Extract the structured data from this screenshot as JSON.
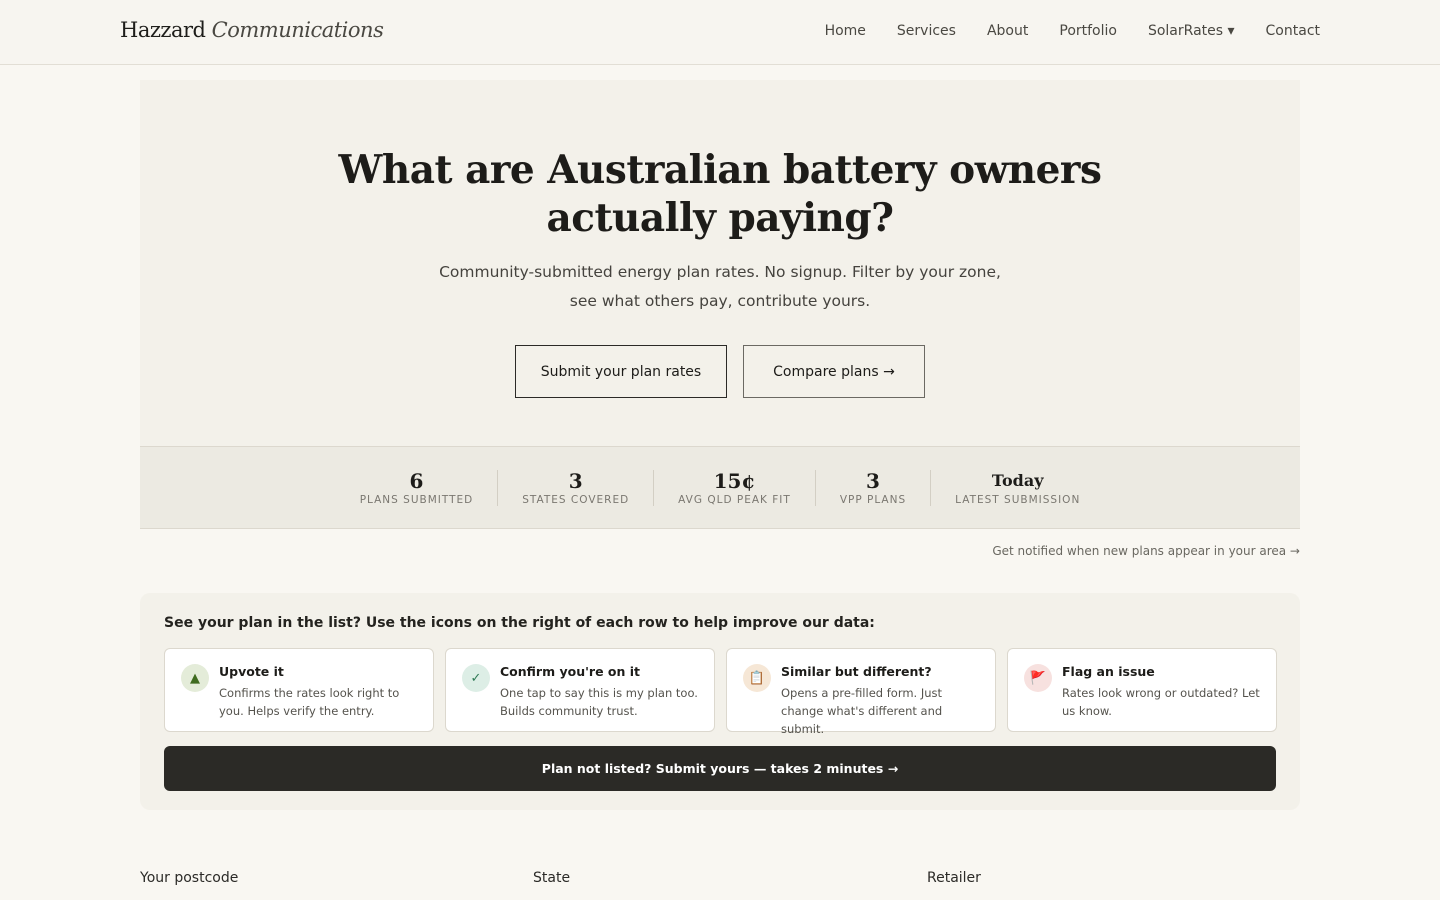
{
  "nav": {
    "brand_main": "Hazzard",
    "brand_italic": "Communications",
    "items": [
      "Home",
      "Services",
      "About",
      "Portfolio",
      "SolarRates ▾",
      "Contact"
    ]
  },
  "hero": {
    "title_line1": "What are Australian battery owners",
    "title_line2": "actually paying?",
    "subtitle_line1": "Community-submitted energy plan rates. No signup. Filter by your zone,",
    "subtitle_line2": "see what others pay, contribute yours.",
    "submit_label": "Submit your plan rates",
    "compare_label": "Compare plans →"
  },
  "stats": [
    {
      "value": "6",
      "label": "PLANS SUBMITTED"
    },
    {
      "value": "3",
      "label": "STATES COVERED"
    },
    {
      "value": "15¢",
      "label": "AVG QLD PEAK FIT"
    },
    {
      "value": "3",
      "label": "VPP PLANS"
    },
    {
      "value": "Today",
      "label": "LATEST SUBMISSION"
    }
  ],
  "notify_link": "Get notified when new plans appear in your area →",
  "help": {
    "title": "See your plan in the list? Use the icons on the right of each row to help improve our data:",
    "cards": [
      {
        "icon": "▲",
        "icon_name": "upvote-icon",
        "title": "Upvote it",
        "desc": "Confirms the rates look right to you. Helps verify the entry.",
        "bg": "#e4ecd9",
        "fg": "#3f6b1f"
      },
      {
        "icon": "✓",
        "icon_name": "check-icon",
        "title": "Confirm you're on it",
        "desc": "One tap to say this is my plan too. Builds community trust.",
        "bg": "#ddeee6",
        "fg": "#2f7a55"
      },
      {
        "icon": "📋",
        "icon_name": "clipboard-icon",
        "title": "Similar but different?",
        "desc": "Opens a pre-filled form. Just change what's different and submit.",
        "bg": "#f6e7d6",
        "fg": "#9a6a33"
      },
      {
        "icon": "🚩",
        "icon_name": "flag-icon",
        "title": "Flag an issue",
        "desc": "Rates look wrong or outdated? Let us know.",
        "bg": "#f7e1df",
        "fg": "#c0392b"
      }
    ],
    "cta_label": "Plan not listed? Submit yours — takes 2 minutes →"
  },
  "filters": {
    "postcode_label": "Your postcode",
    "state_label": "State",
    "retailer_label": "Retailer"
  }
}
